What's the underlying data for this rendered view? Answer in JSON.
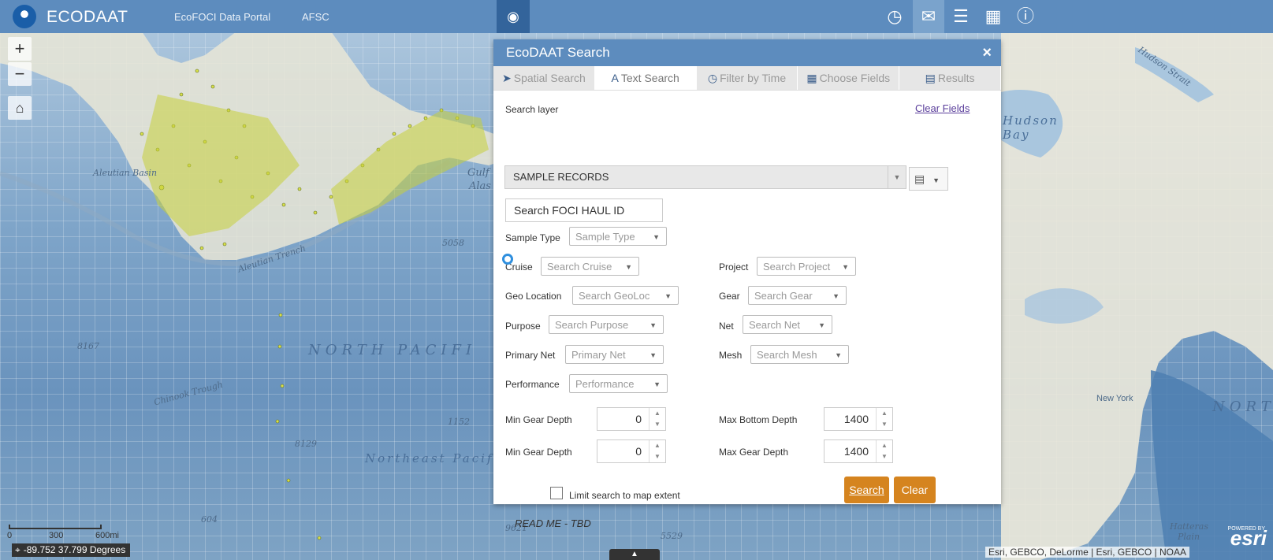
{
  "header": {
    "app_title": "ECODAAT",
    "links": [
      "EcoFOCI Data Portal",
      "AFSC"
    ],
    "icons": [
      "noaa-logo",
      "binoculars-icon",
      "history-icon",
      "chat-icon",
      "layers-icon",
      "grid-icon",
      "info-icon"
    ]
  },
  "map": {
    "labels": {
      "aleutian_basin": "Aleutian Basin",
      "aleutian_trench": "Aleutian Trench",
      "north_pacific": "NORTH PACIFI",
      "northeast_pacific_basin": "Northeast Pacific Basin",
      "chinook_trough": "Chinook Trough",
      "gulf": "Gulf",
      "alaska": "Alas",
      "hudson_bay": "Hudson Bay",
      "hudson_strait": "Hudson Strait",
      "new_york": "New York",
      "north_right": "NORT",
      "hatteras_plain": "Hatteras Plain",
      "depth_5058": "5058",
      "depth_8167": "8167",
      "depth_1152": "1152",
      "depth_8129": "8129",
      "depth_604": "604",
      "depth_9621": "9621",
      "depth_5529": "5529"
    },
    "scale": {
      "zero": "0",
      "mid": "300",
      "end": "600mi"
    },
    "coordinates": "-89.752 37.799 Degrees",
    "attribution": "Esri, GEBCO, DeLorme | Esri, GEBCO | NOAA",
    "powered_by": "POWERED BY",
    "esri": "esri"
  },
  "dialog": {
    "title": "EcoDAAT Search",
    "close": "×",
    "tabs": [
      {
        "label": "Spatial Search",
        "icon": "cursor-icon"
      },
      {
        "label": "Text Search",
        "icon": "text-icon"
      },
      {
        "label": "Filter by Time",
        "icon": "clock-icon"
      },
      {
        "label": "Choose Fields",
        "icon": "table-icon"
      },
      {
        "label": "Results",
        "icon": "results-icon"
      }
    ],
    "search_layer_label": "Search layer",
    "clear_fields": "Clear Fields",
    "layer_value": "SAMPLE RECORDS",
    "haul_id_placeholder": "Search FOCI HAUL ID",
    "fields": {
      "sample_type": {
        "label": "Sample Type",
        "placeholder": "Sample Type"
      },
      "cruise": {
        "label": "Cruise",
        "placeholder": "Search Cruise"
      },
      "project": {
        "label": "Project",
        "placeholder": "Search Project"
      },
      "geo_location": {
        "label": "Geo Location",
        "placeholder": "Search GeoLoc"
      },
      "gear": {
        "label": "Gear",
        "placeholder": "Search Gear"
      },
      "purpose": {
        "label": "Purpose",
        "placeholder": "Search Purpose"
      },
      "net": {
        "label": "Net",
        "placeholder": "Search Net"
      },
      "primary_net": {
        "label": "Primary Net",
        "placeholder": "Primary Net"
      },
      "mesh": {
        "label": "Mesh",
        "placeholder": "Search Mesh"
      },
      "performance": {
        "label": "Performance",
        "placeholder": "Performance"
      }
    },
    "depths": {
      "min_gear_depth_1": {
        "label": "Min Gear Depth",
        "value": "0"
      },
      "max_bottom_depth": {
        "label": "Max Bottom Depth",
        "value": "1400"
      },
      "min_gear_depth_2": {
        "label": "Min Gear Depth",
        "value": "0"
      },
      "max_gear_depth": {
        "label": "Max Gear Depth",
        "value": "1400"
      }
    },
    "limit_label": "Limit search to map extent",
    "search_button": "Search",
    "clear_button": "Clear",
    "readme": "READ ME - TBD"
  }
}
